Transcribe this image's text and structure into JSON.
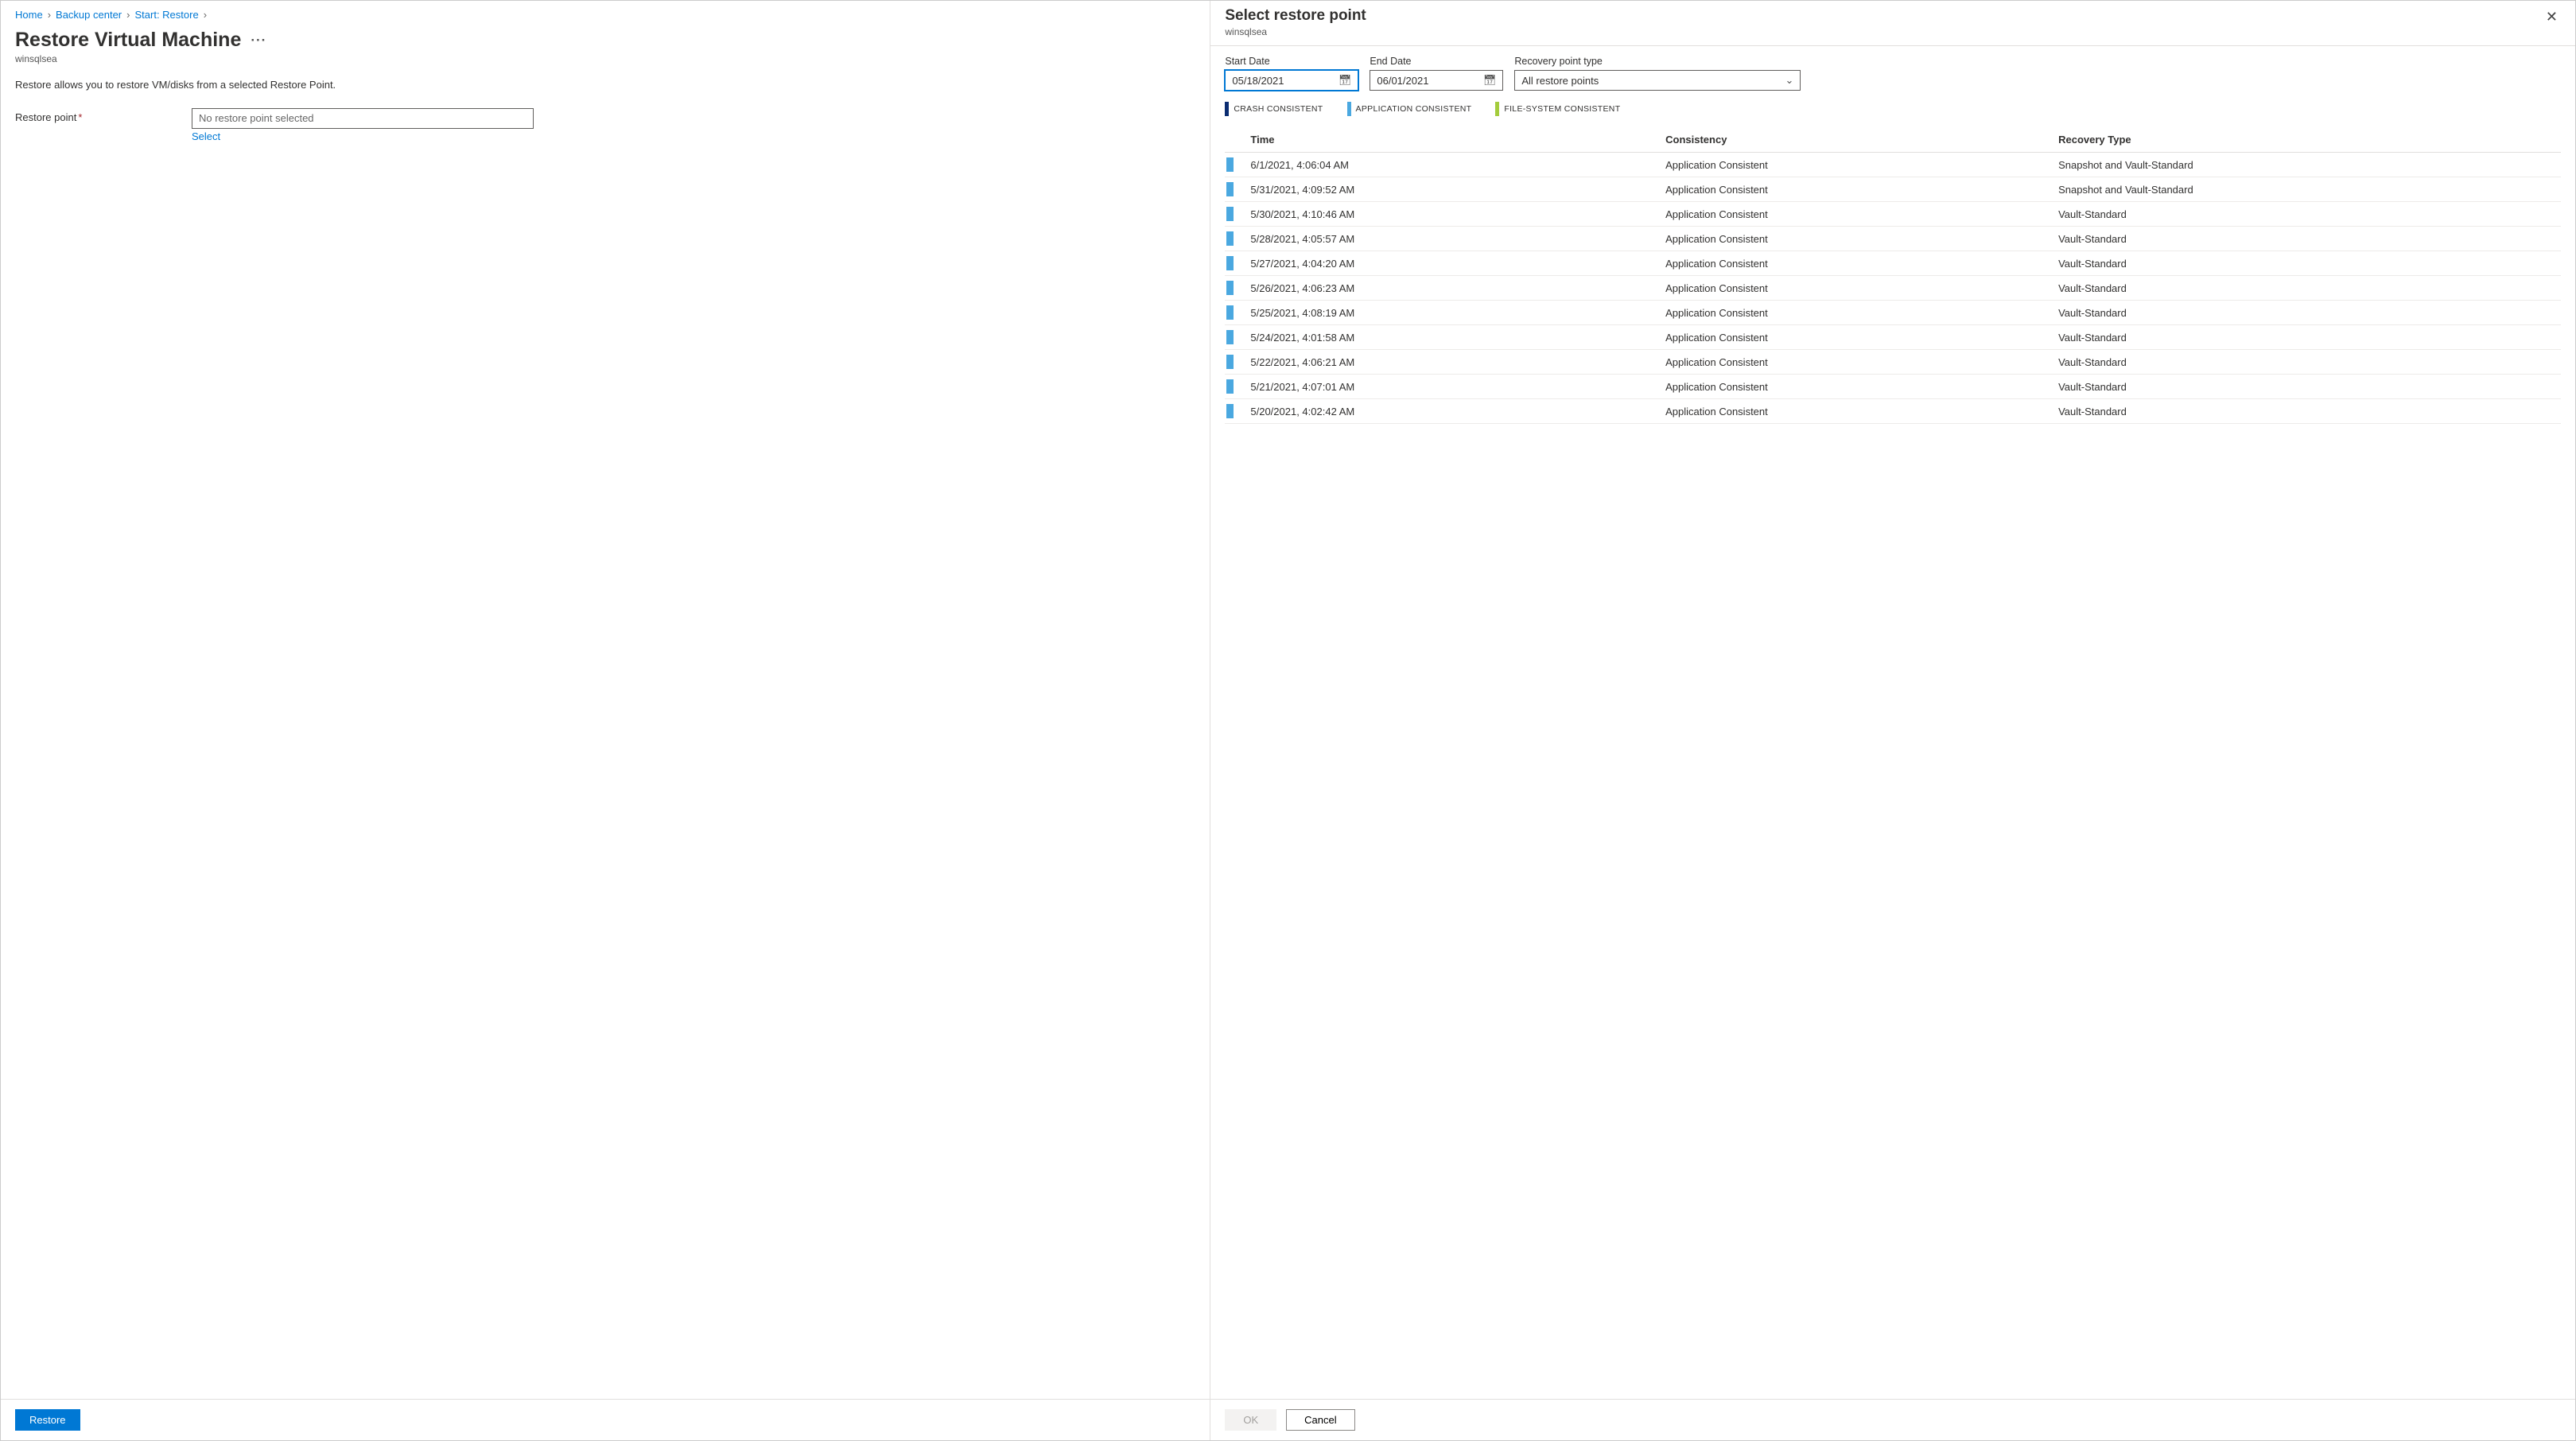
{
  "breadcrumb": [
    "Home",
    "Backup center",
    "Start: Restore"
  ],
  "page": {
    "title": "Restore Virtual Machine",
    "resource": "winsqlsea",
    "description": "Restore allows you to restore VM/disks from a selected Restore Point."
  },
  "form": {
    "restore_point_label": "Restore point",
    "restore_point_value": "No restore point selected",
    "select_link": "Select"
  },
  "footer": {
    "restore_btn": "Restore"
  },
  "panel": {
    "title": "Select restore point",
    "resource": "winsqlsea",
    "filters": {
      "start_label": "Start Date",
      "start_value": "05/18/2021",
      "end_label": "End Date",
      "end_value": "06/01/2021",
      "type_label": "Recovery point type",
      "type_value": "All restore points"
    },
    "legend": {
      "crash": "CRASH CONSISTENT",
      "app": "APPLICATION CONSISTENT",
      "fs": "FILE-SYSTEM CONSISTENT"
    },
    "columns": {
      "time": "Time",
      "consistency": "Consistency",
      "recovery": "Recovery Type"
    },
    "rows": [
      {
        "time": "6/1/2021, 4:06:04 AM",
        "consistency": "Application Consistent",
        "recovery": "Snapshot and Vault-Standard"
      },
      {
        "time": "5/31/2021, 4:09:52 AM",
        "consistency": "Application Consistent",
        "recovery": "Snapshot and Vault-Standard"
      },
      {
        "time": "5/30/2021, 4:10:46 AM",
        "consistency": "Application Consistent",
        "recovery": "Vault-Standard"
      },
      {
        "time": "5/28/2021, 4:05:57 AM",
        "consistency": "Application Consistent",
        "recovery": "Vault-Standard"
      },
      {
        "time": "5/27/2021, 4:04:20 AM",
        "consistency": "Application Consistent",
        "recovery": "Vault-Standard"
      },
      {
        "time": "5/26/2021, 4:06:23 AM",
        "consistency": "Application Consistent",
        "recovery": "Vault-Standard"
      },
      {
        "time": "5/25/2021, 4:08:19 AM",
        "consistency": "Application Consistent",
        "recovery": "Vault-Standard"
      },
      {
        "time": "5/24/2021, 4:01:58 AM",
        "consistency": "Application Consistent",
        "recovery": "Vault-Standard"
      },
      {
        "time": "5/22/2021, 4:06:21 AM",
        "consistency": "Application Consistent",
        "recovery": "Vault-Standard"
      },
      {
        "time": "5/21/2021, 4:07:01 AM",
        "consistency": "Application Consistent",
        "recovery": "Vault-Standard"
      },
      {
        "time": "5/20/2021, 4:02:42 AM",
        "consistency": "Application Consistent",
        "recovery": "Vault-Standard"
      }
    ],
    "footer": {
      "ok": "OK",
      "cancel": "Cancel"
    }
  }
}
